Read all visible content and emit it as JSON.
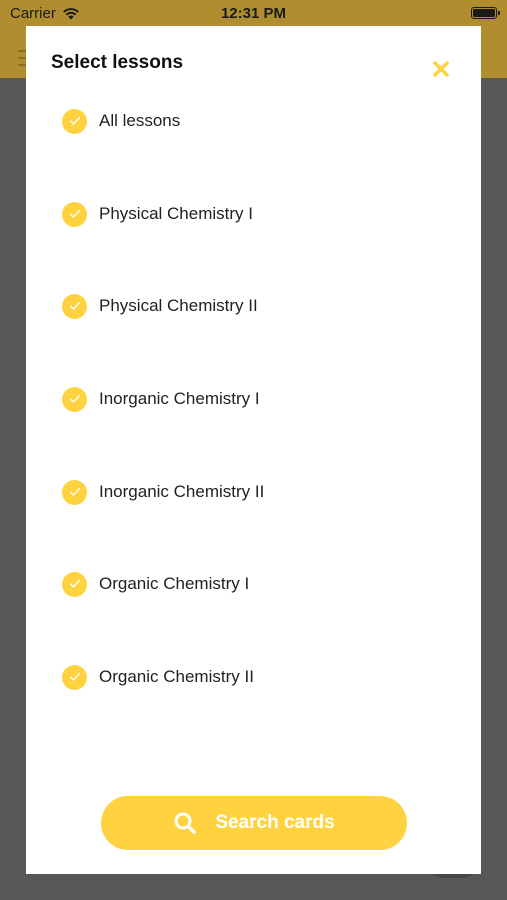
{
  "status_bar": {
    "carrier": "Carrier",
    "time": "12:31 PM"
  },
  "modal": {
    "title": "Select lessons",
    "lessons": [
      {
        "label": "All lessons",
        "checked": true
      },
      {
        "label": "Physical Chemistry I",
        "checked": true
      },
      {
        "label": "Physical Chemistry II",
        "checked": true
      },
      {
        "label": "Inorganic Chemistry I",
        "checked": true
      },
      {
        "label": "Inorganic Chemistry II",
        "checked": true
      },
      {
        "label": "Organic Chemistry I",
        "checked": true
      },
      {
        "label": "Organic Chemistry II",
        "checked": true
      }
    ],
    "search_button_label": "Search cards"
  },
  "colors": {
    "accent": "#ffd23f",
    "overlay": "#555555",
    "header": "#b08d2e"
  },
  "icons": {
    "close": "close-icon",
    "check": "check-icon",
    "search": "search-icon",
    "wifi": "wifi-icon",
    "battery": "battery-icon"
  }
}
